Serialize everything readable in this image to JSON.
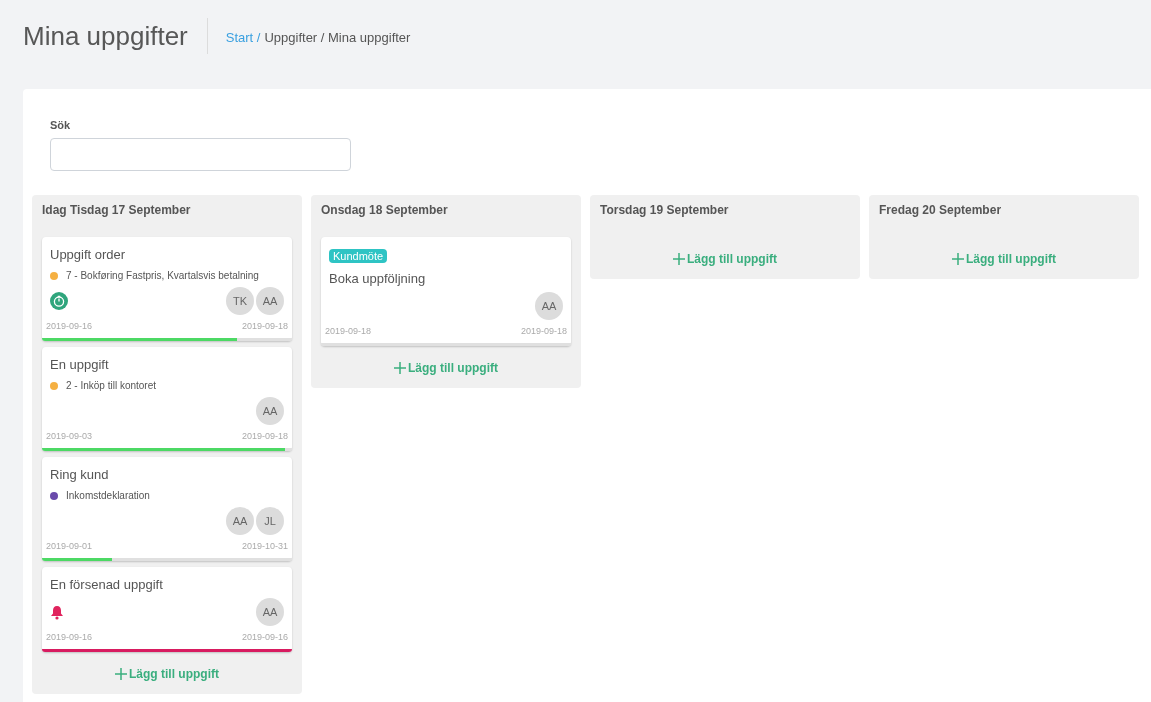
{
  "page_title": "Mina uppgifter",
  "breadcrumb": [
    {
      "text": "Start /",
      "kind": "link"
    },
    {
      "text": "Uppgifter / Mina uppgifter",
      "kind": "text"
    }
  ],
  "search": {
    "label": "Sök"
  },
  "columns": [
    {
      "title": "Idag Tisdag 17 September",
      "add_label": "Lägg till uppgift",
      "cards": [
        {
          "title": "Uppgift order",
          "project": {
            "text": "7 - Bokføring Fastpris, Kvartalsvis betalning",
            "color": "#f5b042"
          },
          "kind": "timer",
          "assignees": [
            "TK",
            "AA"
          ],
          "start": "2019-09-16",
          "end": "2019-09-18",
          "level": 0.78,
          "overdue": false
        },
        {
          "title": "En uppgift",
          "project": {
            "text": "2 - Inköp till kontoret",
            "color": "#f5b042"
          },
          "assignees": [
            "AA"
          ],
          "start": "2019-09-03",
          "end": "2019-09-18",
          "level": 0.97,
          "overdue": false
        },
        {
          "title": "Ring kund",
          "project": {
            "text": "Inkomstdeklaration",
            "color": "#6a4bab"
          },
          "assignees": [
            "AA",
            "JL"
          ],
          "start": "2019-09-01",
          "end": "2019-10-31",
          "level": 0.28,
          "overdue": false
        },
        {
          "title": "En försenad uppgift",
          "kind": "bell",
          "assignees": [
            "AA"
          ],
          "start": "2019-09-16",
          "end": "2019-09-16",
          "level": 1,
          "overdue": true
        }
      ]
    },
    {
      "title": "Onsdag 18 September",
      "add_label": "Lägg till uppgift",
      "cards": [
        {
          "tag": {
            "text": "Kundmöte",
            "color": "#2ec4c4"
          },
          "title": "Boka uppföljning",
          "assignees": [
            "AA"
          ],
          "start": "2019-09-18",
          "end": "2019-09-18"
        }
      ]
    },
    {
      "title": "Torsdag 19 September",
      "add_label": "Lägg till uppgift"
    },
    {
      "title": "Fredag 20 September",
      "add_label": "Lägg till uppgift"
    }
  ]
}
